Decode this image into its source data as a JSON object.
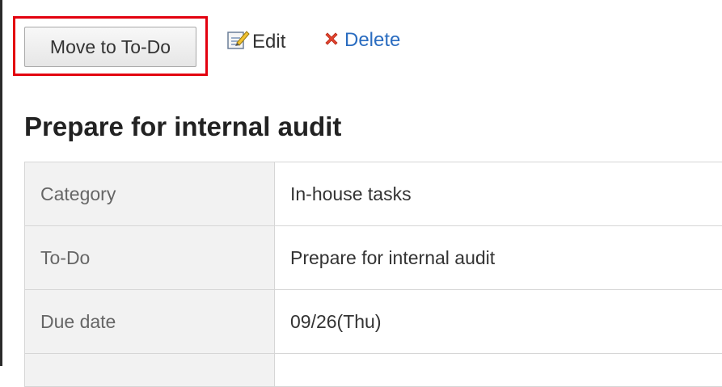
{
  "toolbar": {
    "move_label": "Move to To-Do",
    "edit_label": "Edit",
    "delete_label": "Delete"
  },
  "page_title": "Prepare for internal audit",
  "details": [
    {
      "label": "Category",
      "value": "In-house tasks"
    },
    {
      "label": "To-Do",
      "value": "Prepare for internal audit"
    },
    {
      "label": "Due date",
      "value": "09/26(Thu)"
    }
  ],
  "colors": {
    "highlight": "#e3000f",
    "link": "#2a6cc0",
    "delete_icon": "#e2432e"
  },
  "icons": {
    "edit": "edit-pencil-icon",
    "delete": "delete-x-icon"
  }
}
